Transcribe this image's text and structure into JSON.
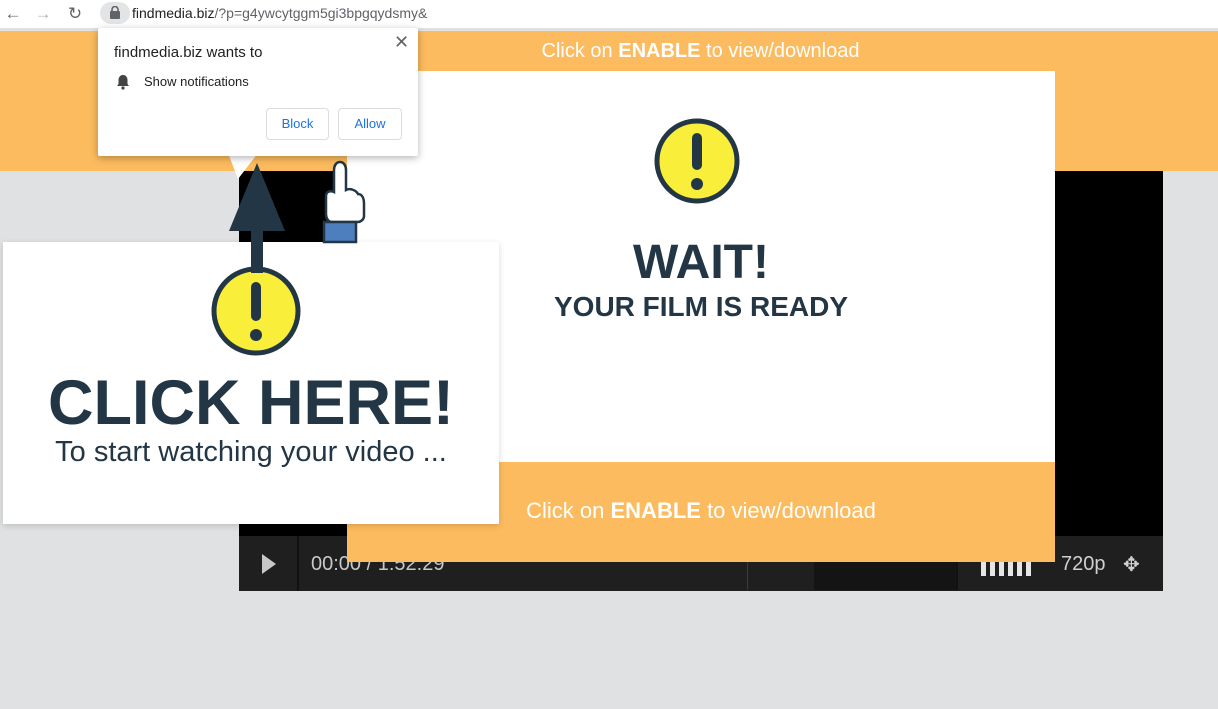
{
  "browser": {
    "nav": {
      "back_icon": "←",
      "forward_icon": "→",
      "reload_icon": "↻"
    },
    "url_domain": "findmedia.biz",
    "url_rest": "/?p=g4ywcytggm5gi3bpgqydsmy&"
  },
  "banner": {
    "prefix": "Click on ",
    "enable": "ENABLE",
    "suffix": " to view/download"
  },
  "center_card": {
    "wait": "WAIT!",
    "ready": "YOUR FILM IS READY",
    "button_prefix": "Click on ",
    "button_enable": "ENABLE",
    "button_suffix": " to view/download"
  },
  "left_card": {
    "headline": "CLICK HERE!",
    "subline": "To start watching your video ..."
  },
  "player": {
    "time": "00:00 / 1:52:29",
    "quality": "720p",
    "fullscreen_icon": "✥"
  },
  "notification": {
    "title": "findmedia.biz wants to",
    "permission": "Show notifications",
    "close_icon": "✕",
    "block_label": "Block",
    "allow_label": "Allow"
  },
  "colors": {
    "orange": "#fcbb5e",
    "navy": "#233645",
    "warning_yellow": "#f9ee39",
    "link_blue": "#1a73e8"
  }
}
